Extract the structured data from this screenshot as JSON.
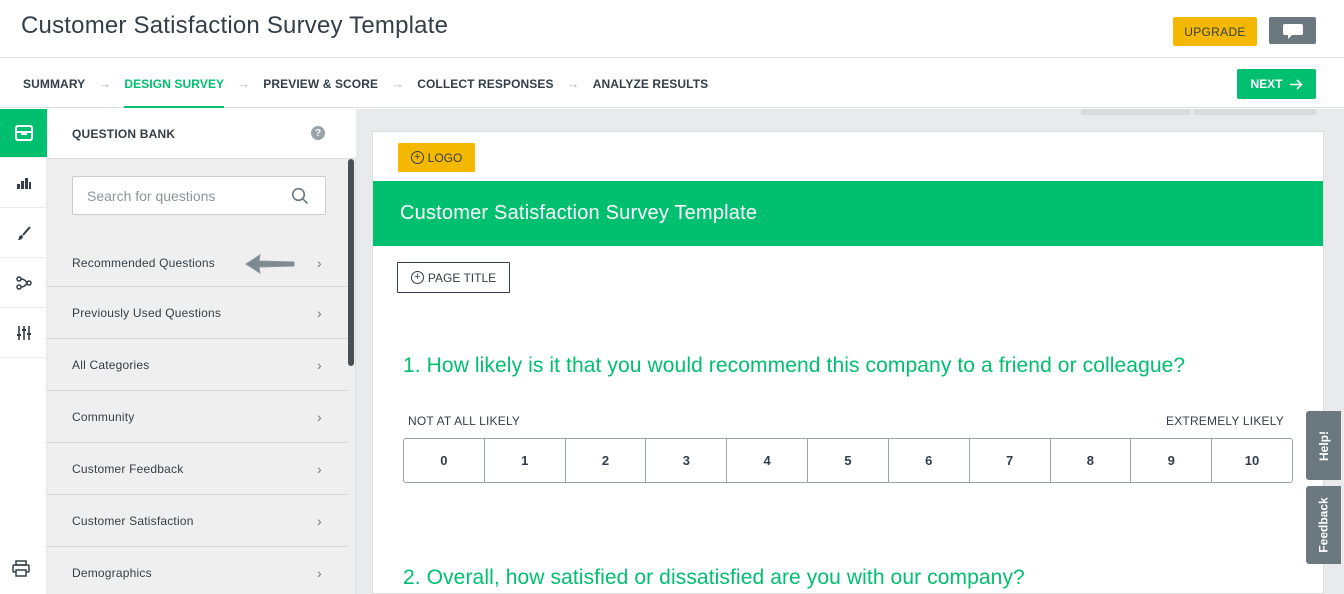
{
  "header": {
    "title": "Customer Satisfaction Survey Template",
    "upgrade_label": "UPGRADE",
    "chat_icon": "speech-bubble-icon"
  },
  "nav": {
    "steps": [
      {
        "label": "SUMMARY",
        "active": false
      },
      {
        "label": "DESIGN SURVEY",
        "active": true
      },
      {
        "label": "PREVIEW & SCORE",
        "active": false
      },
      {
        "label": "COLLECT RESPONSES",
        "active": false
      },
      {
        "label": "ANALYZE RESULTS",
        "active": false
      }
    ],
    "next_label": "NEXT"
  },
  "rail": {
    "items": [
      "question-bank-icon",
      "builder-icon",
      "style-brush-icon",
      "logic-icon",
      "options-sliders-icon"
    ],
    "bottom": "print-icon"
  },
  "question_bank": {
    "title": "QUESTION BANK",
    "help": "?",
    "search_placeholder": "Search for questions",
    "categories": [
      "Recommended Questions",
      "Previously Used Questions",
      "All Categories",
      "Community",
      "Customer Feedback",
      "Customer Satisfaction",
      "Demographics"
    ]
  },
  "survey": {
    "logo_label": "LOGO",
    "title": "Customer Satisfaction Survey Template",
    "page_title_label": "PAGE TITLE",
    "q1": "1. How likely is it that you would recommend this company to a friend or colleague?",
    "q1_low": "NOT AT ALL LIKELY",
    "q1_high": "EXTREMELY LIKELY",
    "scale": [
      "0",
      "1",
      "2",
      "3",
      "4",
      "5",
      "6",
      "7",
      "8",
      "9",
      "10"
    ],
    "q2": "2. Overall, how satisfied or dissatisfied are you with our company?"
  },
  "side_tabs": {
    "help": "Help!",
    "feedback": "Feedback"
  },
  "colors": {
    "brand_green": "#00bf6f",
    "upgrade_yellow": "#f5b800",
    "slate": "#6b787f"
  }
}
